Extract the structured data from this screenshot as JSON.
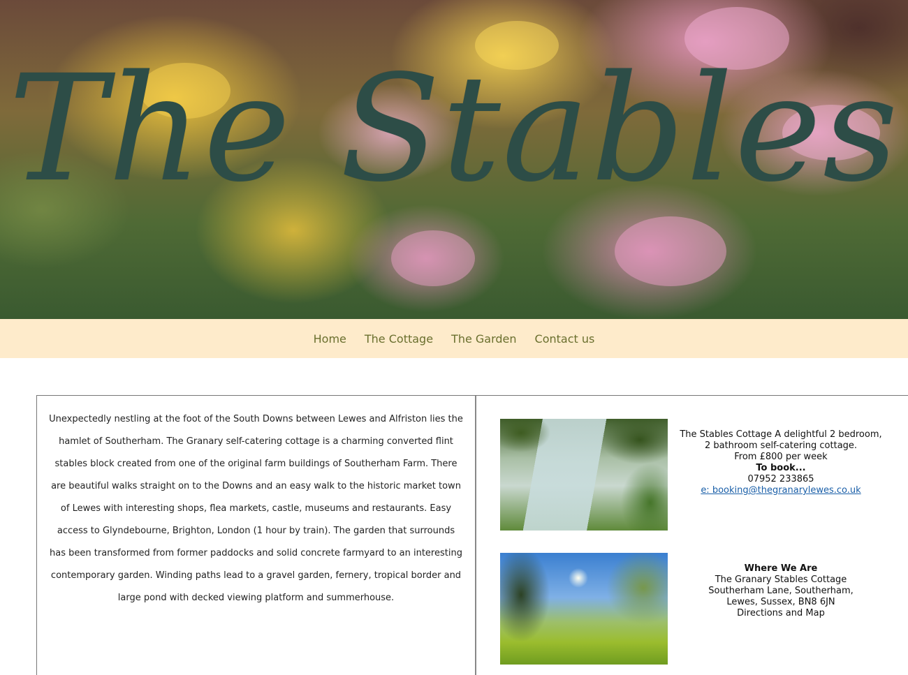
{
  "hero": {
    "title": "The Stables"
  },
  "nav": {
    "items": [
      {
        "label": "Home"
      },
      {
        "label": "The Cottage"
      },
      {
        "label": "The Garden"
      },
      {
        "label": "Contact us"
      }
    ]
  },
  "intro": {
    "text": "Unexpectedly nestling at the foot of the South Downs between Lewes and Alfriston lies the hamlet of Southerham. The Granary self-catering cottage is a charming converted flint stables block created from one of the original farm buildings of Southerham Farm. There are beautiful walks straight on to the Downs and an easy walk to the historic market town of Lewes with interesting shops, flea markets, castle, museums and restaurants. Easy access to Glyndebourne, Brighton, London (1 hour by train). The garden that surrounds has been transformed from former paddocks and solid concrete farmyard to an interesting contemporary garden. Winding paths lead to a gravel garden, fernery, tropical border and large pond with decked viewing platform and summerhouse."
  },
  "booking": {
    "line1": "The Stables Cottage A delightful 2 bedroom,",
    "line2": "2 bathroom self-catering cottage.",
    "price": "From £800 per week",
    "heading": "To book...",
    "phone": "07952 233865",
    "email": "e: booking@thegranarylewes.co.uk"
  },
  "location": {
    "heading": "Where We Are",
    "line1": "The Granary Stables Cottage",
    "line2": "Southerham Lane, Southerham,",
    "line3": "Lewes, Sussex, BN8 6JN",
    "line4": "Directions and Map"
  },
  "colors": {
    "nav_bg": "#feebcb",
    "nav_text": "#6a6f2e",
    "title": "#2d4d47",
    "link": "#1a5fa8"
  }
}
